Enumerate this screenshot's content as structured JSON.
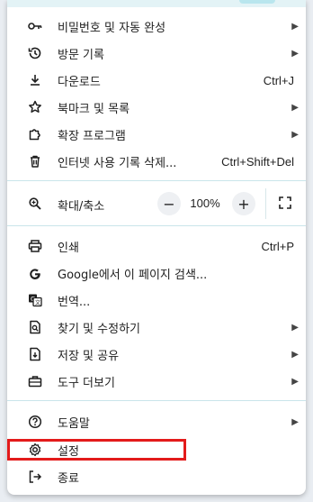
{
  "menu": {
    "group1": [
      {
        "label": "비밀번호 및 자동 완성",
        "icon": "key-icon",
        "submenu": true
      },
      {
        "label": "방문 기록",
        "icon": "history-icon",
        "submenu": true
      },
      {
        "label": "다운로드",
        "icon": "download-icon",
        "shortcut": "Ctrl+J"
      },
      {
        "label": "북마크 및 목록",
        "icon": "star-icon",
        "submenu": true
      },
      {
        "label": "확장 프로그램",
        "icon": "puzzle-icon",
        "submenu": true
      },
      {
        "label": "인터넷 사용 기록 삭제...",
        "icon": "trash-icon",
        "shortcut": "Ctrl+Shift+Del"
      }
    ],
    "zoom": {
      "label": "확대/축소",
      "icon": "zoom-icon",
      "minus": "−",
      "value": "100%",
      "plus": "+",
      "fullscreen_icon": "fullscreen-icon"
    },
    "group2": [
      {
        "label": "인쇄",
        "icon": "print-icon",
        "shortcut": "Ctrl+P"
      },
      {
        "label": "Google에서 이 페이지 검색...",
        "icon": "google-icon"
      },
      {
        "label": "번역...",
        "icon": "translate-icon"
      },
      {
        "label": "찾기 및 수정하기",
        "icon": "find-icon",
        "submenu": true
      },
      {
        "label": "저장 및 공유",
        "icon": "save-share-icon",
        "submenu": true
      },
      {
        "label": "도구 더보기",
        "icon": "toolbox-icon",
        "submenu": true
      }
    ],
    "group3": [
      {
        "label": "도움말",
        "icon": "help-icon",
        "submenu": true
      },
      {
        "label": "설정",
        "icon": "settings-icon",
        "highlighted": true
      },
      {
        "label": "종료",
        "icon": "exit-icon"
      }
    ],
    "chevron": "▶",
    "highlight_color": "#e31b1b"
  }
}
